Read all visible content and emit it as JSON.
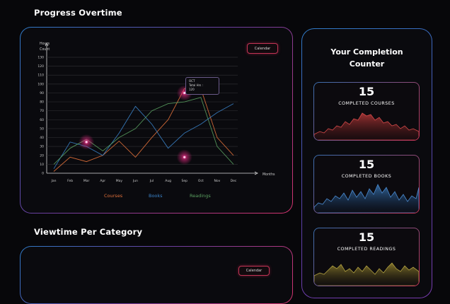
{
  "progress": {
    "title": "Progress Overtime",
    "calendar_label": "Calendar",
    "tooltip": {
      "line1": "OCT",
      "line2": "Total Hrs :",
      "line3": "120"
    }
  },
  "viewtime": {
    "title": "Viewtime Per Category",
    "calendar_label": "Calendar"
  },
  "counter": {
    "title_line1": "Your Completion",
    "title_line2": "Counter",
    "cards": [
      {
        "count": "15",
        "label": "COMPLETED COURSES",
        "color": "#c24040"
      },
      {
        "count": "15",
        "label": "COMPLETED BOOKS",
        "color": "#3a78b8"
      },
      {
        "count": "15",
        "label": "COMPLETED READINGS",
        "color": "#9a8830"
      }
    ]
  },
  "chart_data": {
    "type": "line",
    "ylabel": "Hours Count",
    "xlabel": "Months",
    "ylim": [
      0,
      130
    ],
    "yticks": [
      0,
      10,
      20,
      30,
      40,
      50,
      60,
      70,
      80,
      90,
      100,
      110,
      120,
      130
    ],
    "categories": [
      "Jan",
      "Feb",
      "Mar",
      "Apr",
      "May",
      "Jun",
      "Jul",
      "Aug",
      "Sep",
      "Oct",
      "Nov",
      "Dec"
    ],
    "series": [
      {
        "name": "Courses",
        "color": "#e0703a",
        "values": [
          2,
          18,
          13,
          20,
          36,
          18,
          40,
          60,
          95,
          95,
          40,
          20
        ]
      },
      {
        "name": "Books",
        "color": "#3a82c8",
        "values": [
          5,
          35,
          30,
          20,
          45,
          75,
          55,
          28,
          45,
          55,
          68,
          78
        ]
      },
      {
        "name": "Readings",
        "color": "#5aa060",
        "values": [
          10,
          28,
          38,
          25,
          40,
          50,
          70,
          78,
          80,
          85,
          30,
          10
        ]
      }
    ],
    "legend": "bottom",
    "grid": true,
    "highlights": [
      {
        "x": "Mar",
        "y": 35
      },
      {
        "x": "Sep",
        "y": 90
      },
      {
        "x": "Sep",
        "y": 18
      }
    ]
  }
}
